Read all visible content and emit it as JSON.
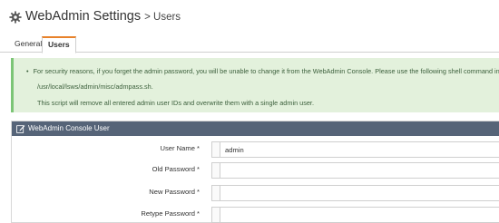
{
  "header": {
    "title": "WebAdmin Settings",
    "subtitle": "> Users"
  },
  "tabs": [
    {
      "label": "General",
      "active": false
    },
    {
      "label": "Users",
      "active": true
    }
  ],
  "alert": {
    "message": "For security reasons, if you forget the admin password, you will be unable to change it from the WebAdmin Console. Please use the following shell command instead:",
    "command": "/usr/local/lsws/admin/misc/admpass.sh.",
    "note": "This script will remove all entered admin user IDs and overwrite them with a single admin user."
  },
  "panel": {
    "title": "WebAdmin Console User",
    "icon": "edit-icon"
  },
  "form": {
    "username_label": "User Name *",
    "username_value": "admin",
    "old_password_label": "Old Password *",
    "new_password_label": "New Password *",
    "retype_password_label": "Retype Password *"
  },
  "colors": {
    "accent_tab": "#e8822a",
    "alert_bg": "#e3f1dc",
    "panel_header": "#566478"
  }
}
